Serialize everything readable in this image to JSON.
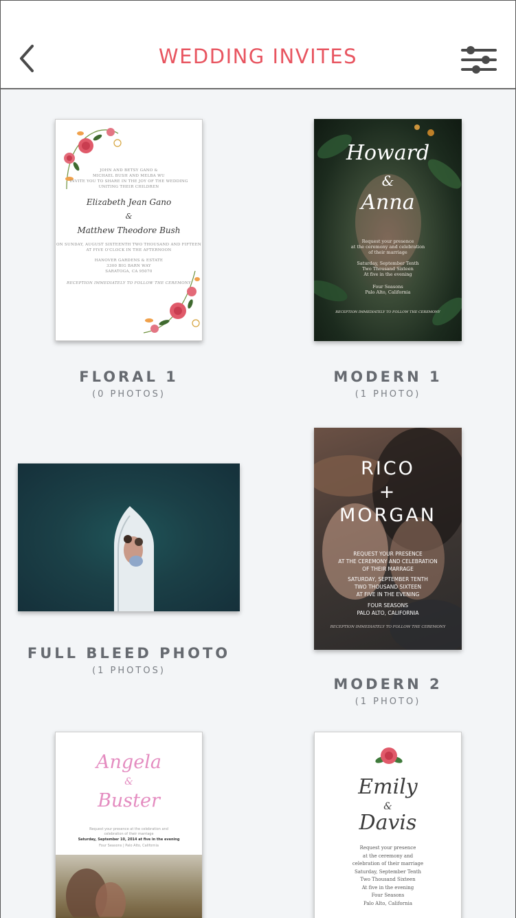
{
  "header": {
    "title": "WEDDING INVITES",
    "accent_color": "#e85560",
    "back_icon": "chevron-left-icon",
    "filter_icon": "sliders-icon"
  },
  "designs": [
    {
      "label": "FLORAL 1",
      "count": "(0 PHOTOS)",
      "preview": {
        "parents": [
          "JOHN AND BETSY GANO &",
          "MICHAEL BUSH AND MELBA WU",
          "INVITE YOU TO SHARE IN THE JOY OF THE WEDDING",
          "UNITING THEIR CHILDREN"
        ],
        "name1": "Elizabeth Jean Gano",
        "amp": "&",
        "name2": "Matthew Theodore Bush",
        "date_lines": [
          "ON SUNDAY, AUGUST SIXTEENTH TWO THOUSAND AND FIFTEEN",
          "AT FIVE O'CLOCK IN THE AFTERNOON"
        ],
        "venue_lines": [
          "HANOVER GARDENS & ESTATE",
          "3300 BIG BARN WAY",
          "SARATOGA, CA 95070"
        ],
        "reception": "RECEPTION IMMEDIATELY TO FOLLOW THE CEREMONY"
      }
    },
    {
      "label": "MODERN 1",
      "count": "(1 PHOTO)",
      "preview": {
        "name1": "Howard",
        "amp": "&",
        "name2": "Anna",
        "lines": [
          "Request your presence",
          "at the ceremony and celebration",
          "of their marriage",
          "",
          "Saturday, September Tenth",
          "Two Thousand Sixteen",
          "At five in the evening",
          "",
          "Four Seasons",
          "Palo Alto, California"
        ],
        "reception": "RECEPTION IMMEDIATELY TO FOLLOW THE CEREMONY"
      }
    },
    {
      "label": "FULL BLEED PHOTO",
      "count": "(1 PHOTOS)"
    },
    {
      "label": "MODERN 2",
      "count": "(1 PHOTO)",
      "preview": {
        "name1": "RICO",
        "amp": "+",
        "name2": "MORGAN",
        "lines": [
          "REQUEST YOUR PRESENCE",
          "AT THE CEREMONY AND CELEBRATION",
          "OF THEIR MARRAGE",
          "",
          "SATURDAY, SEPTEMBER TENTH",
          "TWO THOUSAND SIXTEEN",
          "AT FIVE IN THE EVENING",
          "",
          "FOUR SEASONS",
          "PALO ALTO, CALIFORNIA"
        ],
        "reception": "RECEPTION IMMEDIATELY TO FOLLOW THE CEREMONY"
      }
    },
    {
      "preview": {
        "name1": "Angela",
        "amp": "&",
        "name2": "Buster",
        "line1": "Request your presence at the celebration and",
        "line2": "celebration of their marriage",
        "line3": "Saturday, September 10, 2014 at five in the evening",
        "line4": "Four Seasons | Palo Alto, California"
      }
    },
    {
      "preview": {
        "name1": "Emily",
        "amp": "&",
        "name2": "Davis",
        "lines": [
          "Request your presence",
          "at the ceremony and",
          "celebration of their marriage",
          "Saturday, September Tenth",
          "Two Thousand Sixteen",
          "At five in the evening",
          "Four Seasons",
          "Palo Alto, California"
        ]
      }
    }
  ]
}
